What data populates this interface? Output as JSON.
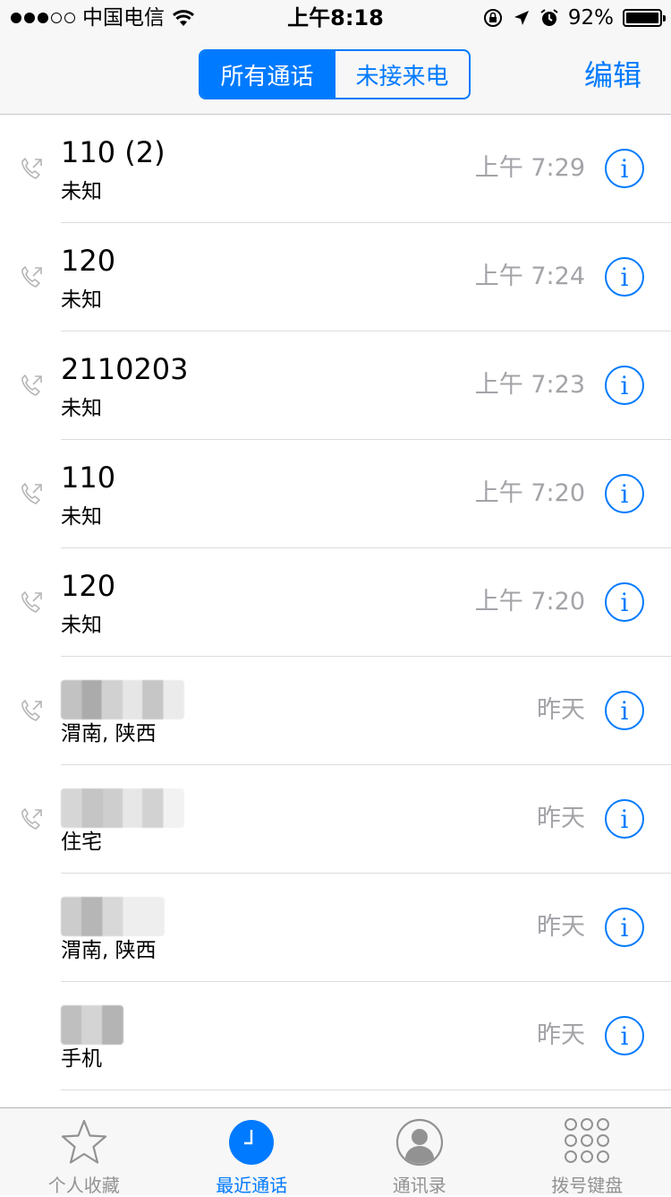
{
  "status_bar": {
    "carrier": "中国电信",
    "time": "上午8:18",
    "battery": "92%",
    "signal_bars": 3
  },
  "nav": {
    "segments": [
      "所有通话",
      "未接来电"
    ],
    "selected": 0,
    "edit": "编辑"
  },
  "calls": [
    {
      "name": "110 (2)",
      "subtitle": "未知",
      "time": "上午 7:29",
      "outgoing": true
    },
    {
      "name": "120",
      "subtitle": "未知",
      "time": "上午 7:24",
      "outgoing": true
    },
    {
      "name": "2110203",
      "subtitle": "未知",
      "time": "上午 7:23",
      "outgoing": true
    },
    {
      "name": "110",
      "subtitle": "未知",
      "time": "上午 7:20",
      "outgoing": true
    },
    {
      "name": "120",
      "subtitle": "未知",
      "time": "上午 7:20",
      "outgoing": true
    },
    {
      "name": "",
      "subtitle": "渭南, 陕西",
      "time": "昨天",
      "outgoing": true
    },
    {
      "name": "",
      "subtitle": "住宅",
      "time": "昨天",
      "outgoing": true
    },
    {
      "name": "",
      "subtitle": "渭南, 陕西",
      "time": "昨天",
      "outgoing": false
    },
    {
      "name": "",
      "subtitle": "手机",
      "time": "昨天",
      "outgoing": false
    }
  ],
  "info_glyph": "i",
  "tabs": [
    {
      "label": "个人收藏",
      "icon": "star-icon"
    },
    {
      "label": "最近通话",
      "icon": "clock-icon"
    },
    {
      "label": "通讯录",
      "icon": "contacts-icon"
    },
    {
      "label": "拨号键盘",
      "icon": "keypad-icon"
    }
  ],
  "active_tab": 1,
  "colors": {
    "accent": "#007aff",
    "muted": "#a3a3a8",
    "tab_inactive": "#929292"
  }
}
